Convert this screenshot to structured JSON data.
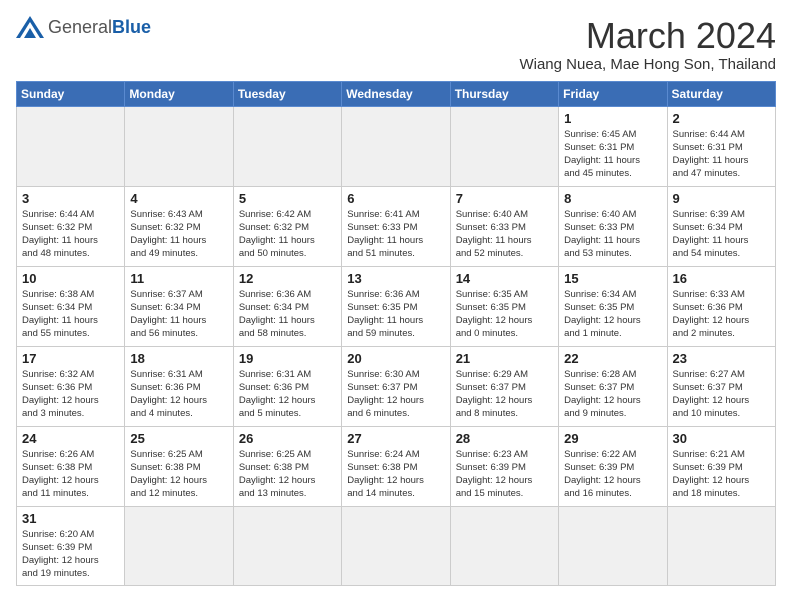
{
  "header": {
    "logo_general": "General",
    "logo_blue": "Blue",
    "month_title": "March 2024",
    "location": "Wiang Nuea, Mae Hong Son, Thailand"
  },
  "days_of_week": [
    "Sunday",
    "Monday",
    "Tuesday",
    "Wednesday",
    "Thursday",
    "Friday",
    "Saturday"
  ],
  "weeks": [
    [
      {
        "day": "",
        "info": ""
      },
      {
        "day": "",
        "info": ""
      },
      {
        "day": "",
        "info": ""
      },
      {
        "day": "",
        "info": ""
      },
      {
        "day": "",
        "info": ""
      },
      {
        "day": "1",
        "info": "Sunrise: 6:45 AM\nSunset: 6:31 PM\nDaylight: 11 hours\nand 45 minutes."
      },
      {
        "day": "2",
        "info": "Sunrise: 6:44 AM\nSunset: 6:31 PM\nDaylight: 11 hours\nand 47 minutes."
      }
    ],
    [
      {
        "day": "3",
        "info": "Sunrise: 6:44 AM\nSunset: 6:32 PM\nDaylight: 11 hours\nand 48 minutes."
      },
      {
        "day": "4",
        "info": "Sunrise: 6:43 AM\nSunset: 6:32 PM\nDaylight: 11 hours\nand 49 minutes."
      },
      {
        "day": "5",
        "info": "Sunrise: 6:42 AM\nSunset: 6:32 PM\nDaylight: 11 hours\nand 50 minutes."
      },
      {
        "day": "6",
        "info": "Sunrise: 6:41 AM\nSunset: 6:33 PM\nDaylight: 11 hours\nand 51 minutes."
      },
      {
        "day": "7",
        "info": "Sunrise: 6:40 AM\nSunset: 6:33 PM\nDaylight: 11 hours\nand 52 minutes."
      },
      {
        "day": "8",
        "info": "Sunrise: 6:40 AM\nSunset: 6:33 PM\nDaylight: 11 hours\nand 53 minutes."
      },
      {
        "day": "9",
        "info": "Sunrise: 6:39 AM\nSunset: 6:34 PM\nDaylight: 11 hours\nand 54 minutes."
      }
    ],
    [
      {
        "day": "10",
        "info": "Sunrise: 6:38 AM\nSunset: 6:34 PM\nDaylight: 11 hours\nand 55 minutes."
      },
      {
        "day": "11",
        "info": "Sunrise: 6:37 AM\nSunset: 6:34 PM\nDaylight: 11 hours\nand 56 minutes."
      },
      {
        "day": "12",
        "info": "Sunrise: 6:36 AM\nSunset: 6:34 PM\nDaylight: 11 hours\nand 58 minutes."
      },
      {
        "day": "13",
        "info": "Sunrise: 6:36 AM\nSunset: 6:35 PM\nDaylight: 11 hours\nand 59 minutes."
      },
      {
        "day": "14",
        "info": "Sunrise: 6:35 AM\nSunset: 6:35 PM\nDaylight: 12 hours\nand 0 minutes."
      },
      {
        "day": "15",
        "info": "Sunrise: 6:34 AM\nSunset: 6:35 PM\nDaylight: 12 hours\nand 1 minute."
      },
      {
        "day": "16",
        "info": "Sunrise: 6:33 AM\nSunset: 6:36 PM\nDaylight: 12 hours\nand 2 minutes."
      }
    ],
    [
      {
        "day": "17",
        "info": "Sunrise: 6:32 AM\nSunset: 6:36 PM\nDaylight: 12 hours\nand 3 minutes."
      },
      {
        "day": "18",
        "info": "Sunrise: 6:31 AM\nSunset: 6:36 PM\nDaylight: 12 hours\nand 4 minutes."
      },
      {
        "day": "19",
        "info": "Sunrise: 6:31 AM\nSunset: 6:36 PM\nDaylight: 12 hours\nand 5 minutes."
      },
      {
        "day": "20",
        "info": "Sunrise: 6:30 AM\nSunset: 6:37 PM\nDaylight: 12 hours\nand 6 minutes."
      },
      {
        "day": "21",
        "info": "Sunrise: 6:29 AM\nSunset: 6:37 PM\nDaylight: 12 hours\nand 8 minutes."
      },
      {
        "day": "22",
        "info": "Sunrise: 6:28 AM\nSunset: 6:37 PM\nDaylight: 12 hours\nand 9 minutes."
      },
      {
        "day": "23",
        "info": "Sunrise: 6:27 AM\nSunset: 6:37 PM\nDaylight: 12 hours\nand 10 minutes."
      }
    ],
    [
      {
        "day": "24",
        "info": "Sunrise: 6:26 AM\nSunset: 6:38 PM\nDaylight: 12 hours\nand 11 minutes."
      },
      {
        "day": "25",
        "info": "Sunrise: 6:25 AM\nSunset: 6:38 PM\nDaylight: 12 hours\nand 12 minutes."
      },
      {
        "day": "26",
        "info": "Sunrise: 6:25 AM\nSunset: 6:38 PM\nDaylight: 12 hours\nand 13 minutes."
      },
      {
        "day": "27",
        "info": "Sunrise: 6:24 AM\nSunset: 6:38 PM\nDaylight: 12 hours\nand 14 minutes."
      },
      {
        "day": "28",
        "info": "Sunrise: 6:23 AM\nSunset: 6:39 PM\nDaylight: 12 hours\nand 15 minutes."
      },
      {
        "day": "29",
        "info": "Sunrise: 6:22 AM\nSunset: 6:39 PM\nDaylight: 12 hours\nand 16 minutes."
      },
      {
        "day": "30",
        "info": "Sunrise: 6:21 AM\nSunset: 6:39 PM\nDaylight: 12 hours\nand 18 minutes."
      }
    ],
    [
      {
        "day": "31",
        "info": "Sunrise: 6:20 AM\nSunset: 6:39 PM\nDaylight: 12 hours\nand 19 minutes."
      },
      {
        "day": "",
        "info": ""
      },
      {
        "day": "",
        "info": ""
      },
      {
        "day": "",
        "info": ""
      },
      {
        "day": "",
        "info": ""
      },
      {
        "day": "",
        "info": ""
      },
      {
        "day": "",
        "info": ""
      }
    ]
  ]
}
